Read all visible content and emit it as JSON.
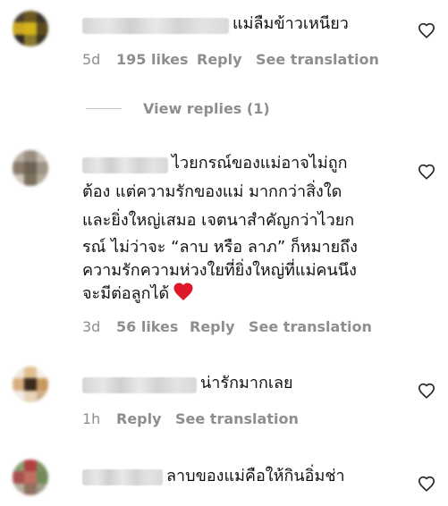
{
  "comments": [
    {
      "text": "แม่ลืมข้าวเหนียว",
      "time": "5d",
      "likes": "195 likes",
      "reply": "Reply",
      "translate": "See translation",
      "view_replies": "View replies (1)",
      "avatar_colors": [
        "#4a4030",
        "#6b5a20",
        "#3a3228",
        "#c9a820",
        "#d4b418",
        "#5a4a20",
        "#2c2820",
        "#8a7a30",
        "#3c3420"
      ]
    },
    {
      "text_lines": [
        "ไวยกรณ์ของแม่อาจไม่ถูก",
        "ต้อง แต่ความรักของแม่ มากกว่าสิ่งใด",
        "และยิ่งใหญ่เสมอ เจตนาสำคัญกว่าไวยก",
        "รณ์ ไม่ว่าจะ “ลาบ หรือ ลาภ” ก็หมายถึง",
        "ความรักความห่วงใยที่ยิ่งใหญ่ที่แม่คนนึง",
        "จะมีต่อลูกได้"
      ],
      "heart": "❤",
      "time": "3d",
      "likes": "56 likes",
      "reply": "Reply",
      "translate": "See translation",
      "avatar_colors": [
        "#b8b0a4",
        "#9a8e80",
        "#c8c0b4",
        "#8a7c6c",
        "#6e6254",
        "#a09484",
        "#d0c8bc",
        "#7c705e",
        "#b4aa9c"
      ]
    },
    {
      "text": "น่ารักมากเลย",
      "time": "1h",
      "reply": "Reply",
      "translate": "See translation",
      "avatar_colors": [
        "#f0e8e0",
        "#e0c090",
        "#f4f0ec",
        "#d8b080",
        "#3a2a1c",
        "#c89a60",
        "#f2ece6",
        "#e8d4b8",
        "#d0b090"
      ]
    },
    {
      "text": "ลาบของแม่คือให้กินอิ่มช่า",
      "avatar_colors": [
        "#8aa070",
        "#b04040",
        "#7c9060",
        "#a85050",
        "#c07060",
        "#708a58",
        "#b8b0a0",
        "#907060",
        "#a0a088"
      ]
    }
  ],
  "icons": {
    "like": "heart-outline-icon"
  }
}
